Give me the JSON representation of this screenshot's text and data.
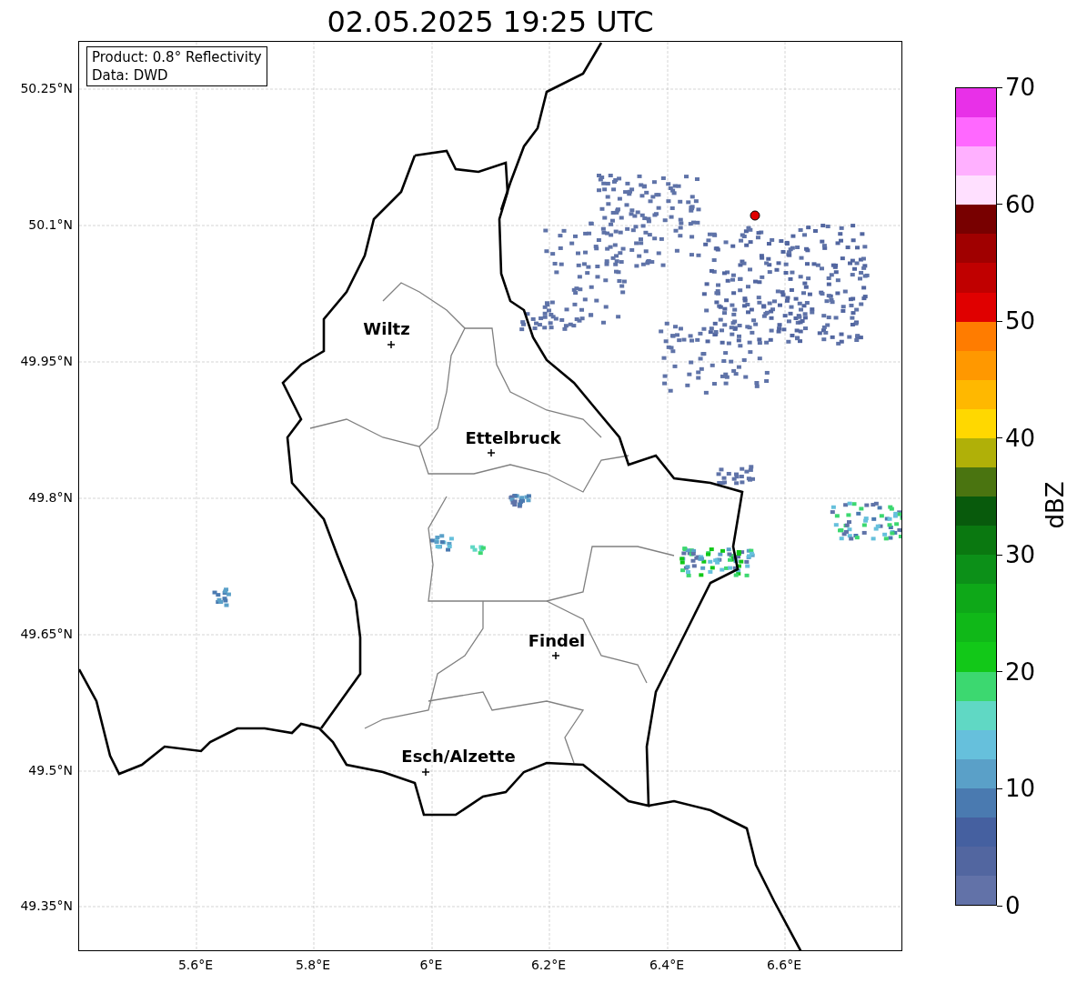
{
  "title": "02.05.2025 19:25 UTC",
  "info_box": [
    "Product: 0.8° Reflectivity",
    "Data: DWD"
  ],
  "map": {
    "cities": [
      {
        "name": "Wiltz"
      },
      {
        "name": "Ettelbruck"
      },
      {
        "name": "Findel"
      },
      {
        "name": "Esch/Alzette"
      }
    ],
    "lat_ticks": [
      "50.25°N",
      "50.1°N",
      "49.95°N",
      "49.8°N",
      "49.65°N",
      "49.5°N",
      "49.35°N"
    ],
    "lon_ticks": [
      "5.6°E",
      "5.8°E",
      "6°E",
      "6.2°E",
      "6.4°E",
      "6.6°E"
    ]
  },
  "colorbar": {
    "label": "dBZ",
    "ticks": [
      "70",
      "60",
      "50",
      "40",
      "30",
      "20",
      "10",
      "0"
    ],
    "bins": [
      {
        "color": "#e830e8"
      },
      {
        "color": "#ff68ff"
      },
      {
        "color": "#ffb0ff"
      },
      {
        "color": "#ffe0ff"
      },
      {
        "color": "#780000"
      },
      {
        "color": "#a00000"
      },
      {
        "color": "#c00000"
      },
      {
        "color": "#e00000"
      },
      {
        "color": "#ff7c00"
      },
      {
        "color": "#ff9800"
      },
      {
        "color": "#ffb800"
      },
      {
        "color": "#ffd800"
      },
      {
        "color": "#b0b008"
      },
      {
        "color": "#4a7410"
      },
      {
        "color": "#085a0c"
      },
      {
        "color": "#0a7810"
      },
      {
        "color": "#0c9018"
      },
      {
        "color": "#0ea818"
      },
      {
        "color": "#10b818"
      },
      {
        "color": "#12c818"
      },
      {
        "color": "#3cd870"
      },
      {
        "color": "#60d8c4"
      },
      {
        "color": "#66c0dc"
      },
      {
        "color": "#5aa0c8"
      },
      {
        "color": "#4a7ab0"
      },
      {
        "color": "#4560a0"
      },
      {
        "color": "#5266a0"
      },
      {
        "color": "#6272a8"
      }
    ]
  }
}
